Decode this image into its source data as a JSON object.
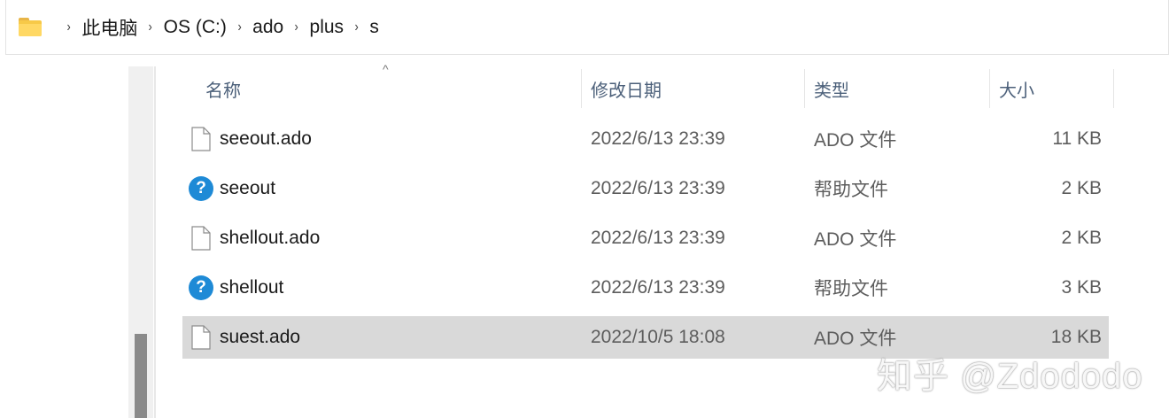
{
  "breadcrumb": {
    "items": [
      "此电脑",
      "OS (C:)",
      "ado",
      "plus",
      "s"
    ],
    "separator": "›"
  },
  "columns": {
    "name": "名称",
    "date": "修改日期",
    "type": "类型",
    "size": "大小",
    "sort_indicator": "^"
  },
  "files": [
    {
      "name": "seeout.ado",
      "date": "2022/6/13 23:39",
      "type": "ADO 文件",
      "size": "11 KB",
      "icon": "file-icon",
      "selected": false
    },
    {
      "name": "seeout",
      "date": "2022/6/13 23:39",
      "type": "帮助文件",
      "size": "2 KB",
      "icon": "help-icon",
      "selected": false
    },
    {
      "name": "shellout.ado",
      "date": "2022/6/13 23:39",
      "type": "ADO 文件",
      "size": "2 KB",
      "icon": "file-icon",
      "selected": false
    },
    {
      "name": "shellout",
      "date": "2022/6/13 23:39",
      "type": "帮助文件",
      "size": "3 KB",
      "icon": "help-icon",
      "selected": false
    },
    {
      "name": "suest.ado",
      "date": "2022/10/5 18:08",
      "type": "ADO 文件",
      "size": "18 KB",
      "icon": "file-icon",
      "selected": true
    }
  ],
  "help_glyph": "?",
  "watermark": "知乎 @Zdododo",
  "colors": {
    "header_text": "#4c607a",
    "selected_row": "#d9d9d9",
    "help_icon": "#1e8ad6",
    "folder": "#f7c948"
  }
}
